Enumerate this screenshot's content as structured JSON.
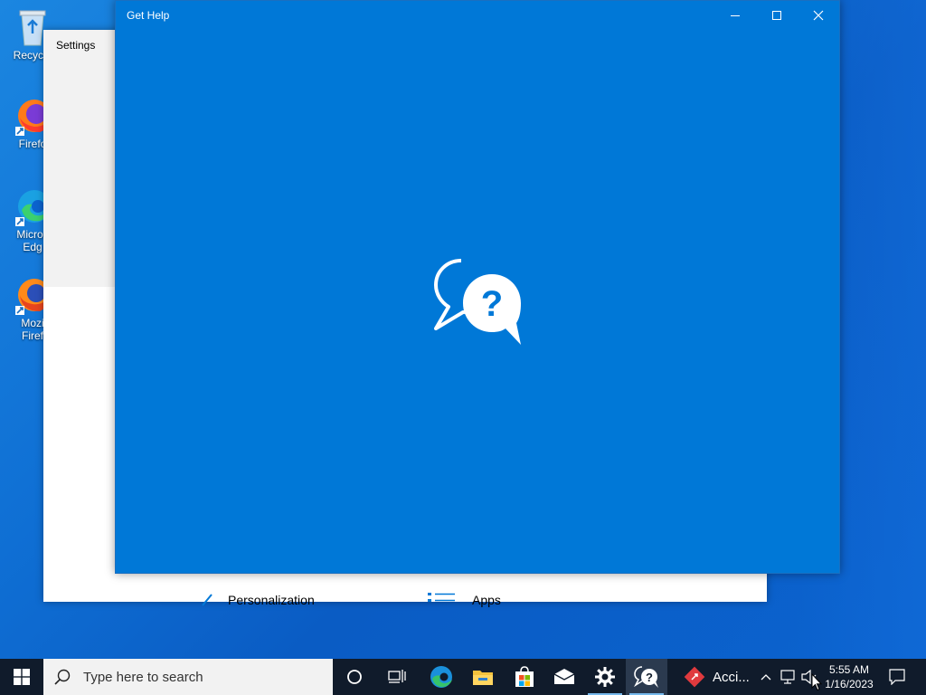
{
  "desktop": {
    "icons": [
      {
        "label": "Recycle",
        "icon": "recycle-bin-icon"
      },
      {
        "label": "Firefo",
        "icon": "firefox-icon"
      },
      {
        "label_line1": "Micros",
        "label_line2": "Edg",
        "icon": "edge-icon"
      },
      {
        "label_line1": "Mozi",
        "label_line2": "Firef",
        "icon": "firefox-icon"
      }
    ]
  },
  "settings_window": {
    "title": "Settings",
    "tiles": [
      {
        "label": "Personalization",
        "icon": "brush-icon"
      },
      {
        "label": "Apps",
        "icon": "apps-list-icon"
      }
    ]
  },
  "gethelp_window": {
    "title": "Get Help",
    "splash_icon": "help-chat-bubbles-icon",
    "buttons": {
      "minimize": "minimize-icon",
      "maximize": "maximize-icon",
      "close": "close-icon"
    }
  },
  "taskbar": {
    "search_placeholder": "Type here to search",
    "pinned": [
      "cortana-icon",
      "task-view-icon",
      "edge-icon",
      "file-explorer-icon",
      "store-icon",
      "mail-icon",
      "settings-icon",
      "get-help-icon"
    ],
    "running_app_label": "Acci...",
    "clock_time": "5:55 AM",
    "clock_date": "1/16/2023"
  },
  "colors": {
    "gethelp_blue": "#0078d7",
    "taskbar": "#101b2b",
    "accent_underline": "#76b9ed"
  }
}
